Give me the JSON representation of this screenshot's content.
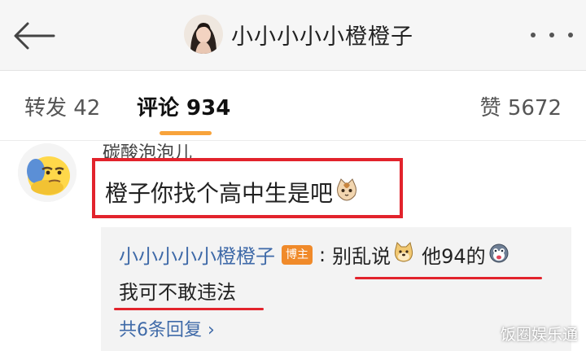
{
  "header": {
    "title": "小小小小小橙橙子",
    "back_icon": "back-arrow-icon",
    "more_icon": "more-dots-icon"
  },
  "tabs": [
    {
      "label": "转发 42"
    },
    {
      "label": "评论 934",
      "active": true
    },
    {
      "label": "赞 5672"
    }
  ],
  "comment": {
    "author": "碳酸泡泡儿",
    "text": "橙子你找个高中生是吧",
    "emoji": "cat-face-emoji"
  },
  "reply": {
    "author": "小小小小小橙橙子",
    "badge": "博主",
    "separator": ":",
    "text_part1": "别乱说",
    "emoji1": "doge-emoji",
    "text_part2": "他94的",
    "emoji2": "husky-emoji",
    "text_line2": "我可不敢违法",
    "more_label": "共6条回复 ›"
  },
  "watermark": "饭圈娱乐通",
  "colors": {
    "accent_orange": "#f8a33b",
    "link_blue": "#3f6aa8",
    "highlight_red": "#e2232c",
    "badge_orange": "#f08a2a"
  }
}
